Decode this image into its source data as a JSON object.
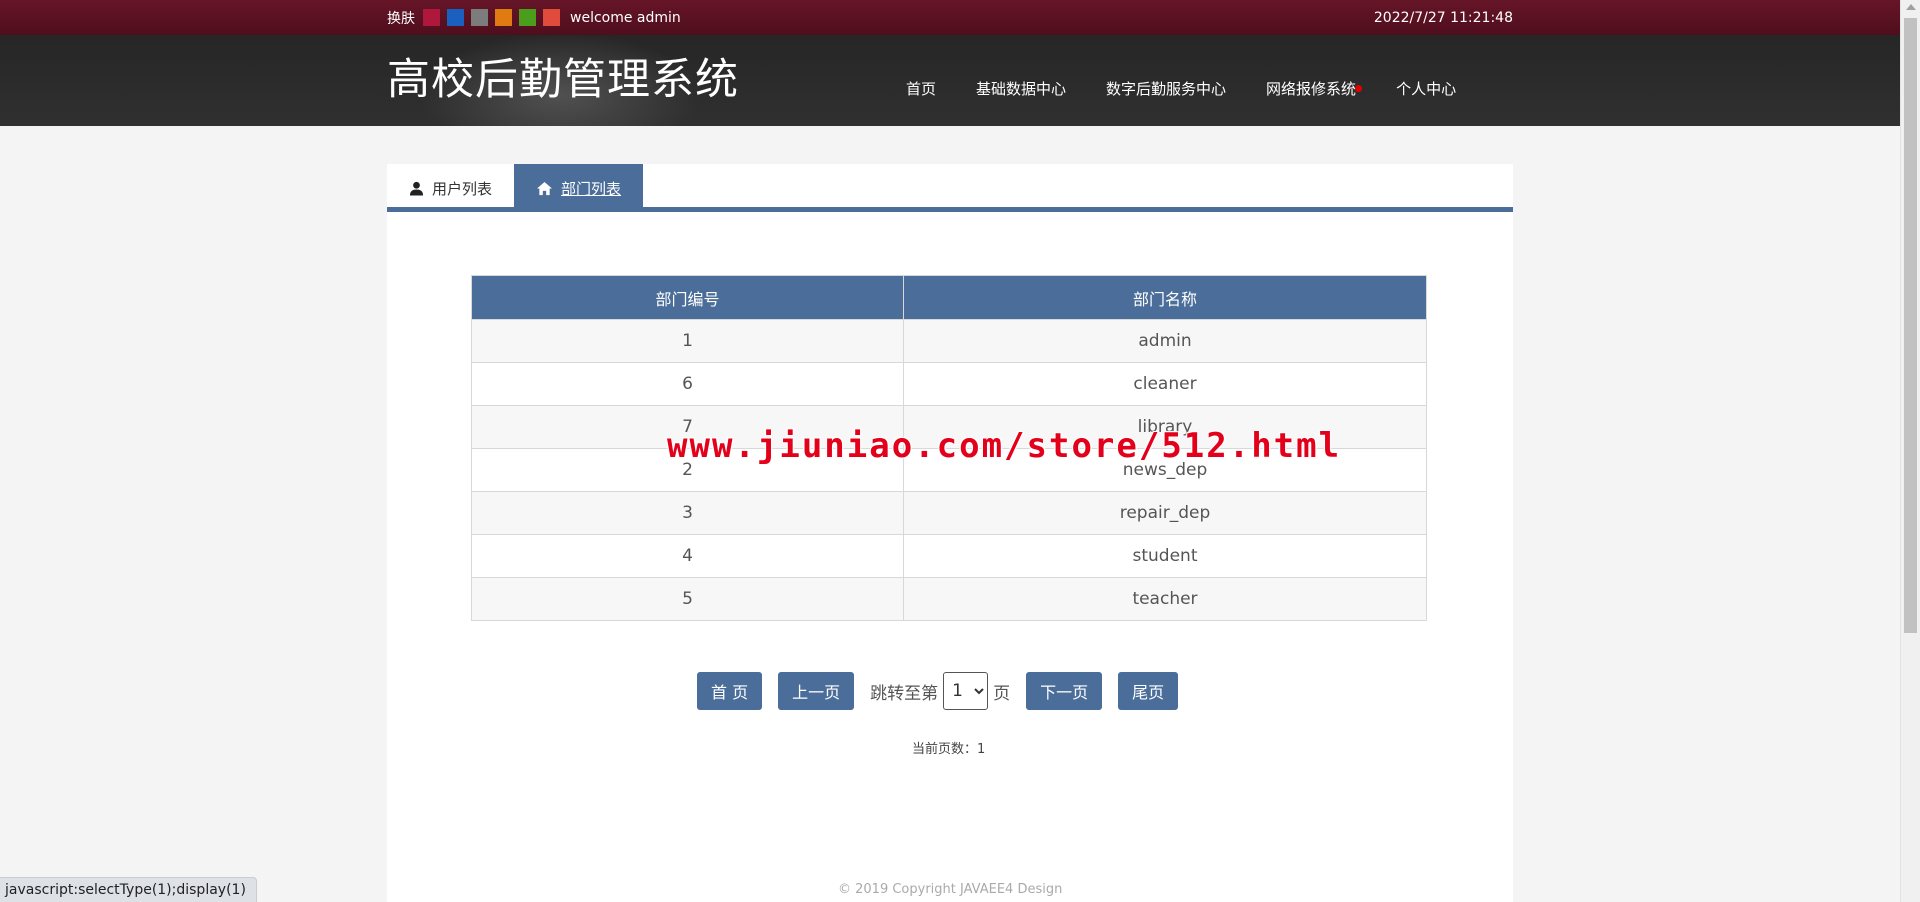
{
  "topbar": {
    "skin_label": "换肤",
    "skins": [
      "#b0173c",
      "#1b5fbf",
      "#7c7c7c",
      "#e07b12",
      "#4a9e1c",
      "#e04b3c"
    ],
    "welcome": "welcome admin",
    "datetime": "2022/7/27 11:21:48"
  },
  "header": {
    "title": "高校后勤管理系统",
    "nav": [
      {
        "label": "首页"
      },
      {
        "label": "基础数据中心"
      },
      {
        "label": "数字后勤服务中心"
      },
      {
        "label": "网络报修系统",
        "badge_color": "#e50000"
      },
      {
        "label": "个人中心"
      }
    ]
  },
  "tabs": [
    {
      "label": "用户列表",
      "icon": "user-icon",
      "active": false
    },
    {
      "label": "部门列表",
      "icon": "home-icon",
      "active": true
    }
  ],
  "table": {
    "columns": [
      "部门编号",
      "部门名称"
    ],
    "rows": [
      {
        "id": "1",
        "name": "admin"
      },
      {
        "id": "6",
        "name": "cleaner"
      },
      {
        "id": "7",
        "name": "library"
      },
      {
        "id": "2",
        "name": "news_dep"
      },
      {
        "id": "3",
        "name": "repair_dep"
      },
      {
        "id": "4",
        "name": "student"
      },
      {
        "id": "5",
        "name": "teacher"
      }
    ]
  },
  "pagination": {
    "first": "首 页",
    "prev": "上一页",
    "jump_label": "跳转至第",
    "selected_page": "1",
    "page_suffix": "页",
    "next": "下一页",
    "last": "尾页",
    "current_label": "当前页数：1"
  },
  "footer": {
    "copyright": "© 2019 Copyright JAVAEE4 Design"
  },
  "watermark": "www.jiuniao.com/store/512.html",
  "statusbar": "javascript:selectType(1);display(1)"
}
